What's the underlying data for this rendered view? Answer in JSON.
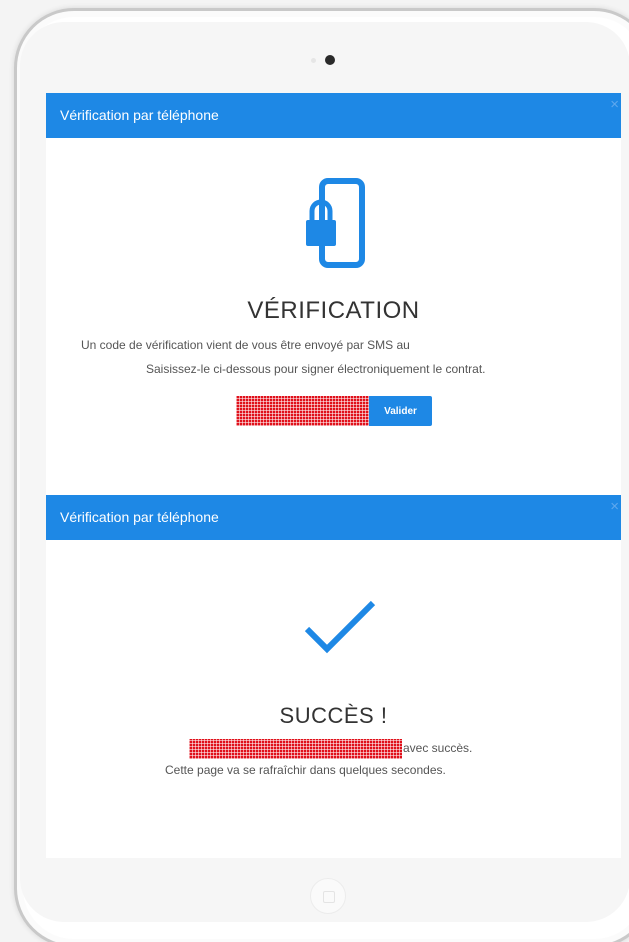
{
  "verification_modal": {
    "header_title": "Vérification par téléphone",
    "close_icon": "×",
    "icon": "phone-lock-icon",
    "title": "VÉRIFICATION",
    "line_1": "Un code de vérification vient de vous être envoyé par SMS au",
    "line_2": "Saisissez-le ci-dessous pour signer électroniquement le contrat.",
    "code_input": {
      "value": "",
      "placeholder": ""
    },
    "submit_label": "Valider"
  },
  "success_modal": {
    "header_title": "Vérification par téléphone",
    "close_icon": "×",
    "icon": "checkmark-icon",
    "title": "SUCCÈS !",
    "line_1_suffix": "avec succès.",
    "line_2": "Cette page va se rafraîchir dans quelques secondes."
  },
  "colors": {
    "accent": "#1e88e5",
    "redaction": "#e0101a"
  }
}
